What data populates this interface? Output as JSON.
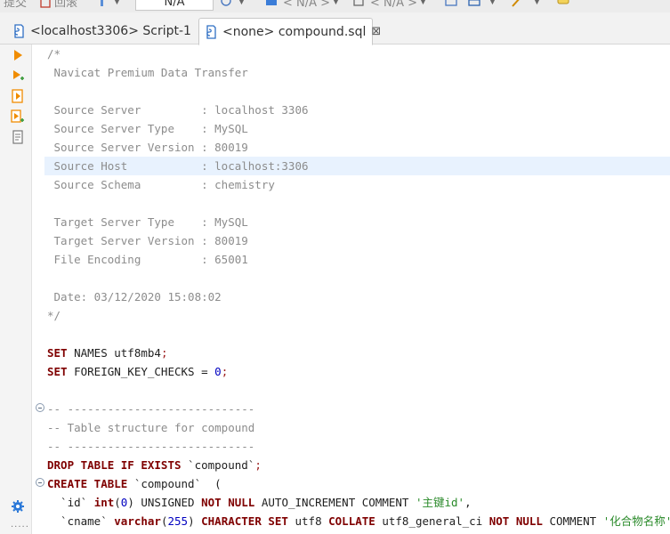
{
  "toolbar": {
    "commit_label": "提交",
    "rollback_label": "回滚",
    "transaction_value": "N/A",
    "datasource_value": "< N/A >",
    "schema_value": "< N/A >"
  },
  "tabs": [
    {
      "label": "<localhost3306> Script-1",
      "active": false
    },
    {
      "label": "<none> compound.sql",
      "active": true,
      "close": "⊠"
    }
  ],
  "gutter_icons": [
    "execute-statement-icon",
    "execute-in-new-tab-icon",
    "execute-script-icon",
    "execute-script-new-tab-icon",
    "explain-plan-icon"
  ],
  "editor": {
    "lines": [
      [
        {
          "t": "/*",
          "c": "cm"
        }
      ],
      [
        {
          "t": " Navicat Premium Data Transfer",
          "c": "cm"
        }
      ],
      [],
      [
        {
          "t": " Source Server         : localhost 3306",
          "c": "cm"
        }
      ],
      [
        {
          "t": " Source Server Type    : MySQL",
          "c": "cm"
        }
      ],
      [
        {
          "t": " Source Server Version : 80019",
          "c": "cm"
        }
      ],
      [
        {
          "t": " Source Host           : localhost:3306",
          "c": "cm"
        }
      ],
      [
        {
          "t": " Source Schema         : chemistry",
          "c": "cm"
        }
      ],
      [],
      [
        {
          "t": " Target Server Type    : MySQL",
          "c": "cm"
        }
      ],
      [
        {
          "t": " Target Server Version : 80019",
          "c": "cm"
        }
      ],
      [
        {
          "t": " File Encoding         : 65001",
          "c": "cm"
        }
      ],
      [],
      [
        {
          "t": " Date: 03/12/2020 15:08:02",
          "c": "cm"
        }
      ],
      [
        {
          "t": "*/",
          "c": "cm"
        }
      ],
      [],
      [
        {
          "t": "SET",
          "c": "kw"
        },
        {
          "t": " NAMES utf8mb4",
          "c": "pl"
        },
        {
          "t": ";",
          "c": "pn"
        }
      ],
      [
        {
          "t": "SET",
          "c": "kw"
        },
        {
          "t": " FOREIGN_KEY_CHECKS = ",
          "c": "pl"
        },
        {
          "t": "0",
          "c": "num"
        },
        {
          "t": ";",
          "c": "pn"
        }
      ],
      [],
      [
        {
          "t": "-- ----------------------------",
          "c": "cm"
        }
      ],
      [
        {
          "t": "-- Table structure for compound",
          "c": "cm"
        }
      ],
      [
        {
          "t": "-- ----------------------------",
          "c": "cm"
        }
      ],
      [
        {
          "t": "DROP TABLE IF EXISTS",
          "c": "kw"
        },
        {
          "t": " `compound`",
          "c": "pl"
        },
        {
          "t": ";",
          "c": "pn"
        }
      ],
      [
        {
          "t": "CREATE TABLE",
          "c": "kw"
        },
        {
          "t": " `compound`  (",
          "c": "pl"
        }
      ],
      [
        {
          "t": "  `id` ",
          "c": "pl"
        },
        {
          "t": "int",
          "c": "kw"
        },
        {
          "t": "(",
          "c": "pl"
        },
        {
          "t": "0",
          "c": "num"
        },
        {
          "t": ") UNSIGNED ",
          "c": "pl"
        },
        {
          "t": "NOT NULL",
          "c": "kw"
        },
        {
          "t": " AUTO_INCREMENT COMMENT ",
          "c": "pl"
        },
        {
          "t": "'主键id'",
          "c": "str"
        },
        {
          "t": ",",
          "c": "pl"
        }
      ],
      [
        {
          "t": "  `cname` ",
          "c": "pl"
        },
        {
          "t": "varchar",
          "c": "kw"
        },
        {
          "t": "(",
          "c": "pl"
        },
        {
          "t": "255",
          "c": "num"
        },
        {
          "t": ") ",
          "c": "pl"
        },
        {
          "t": "CHARACTER SET",
          "c": "kw"
        },
        {
          "t": " utf8 ",
          "c": "pl"
        },
        {
          "t": "COLLATE",
          "c": "kw"
        },
        {
          "t": " utf8_general_ci ",
          "c": "pl"
        },
        {
          "t": "NOT NULL",
          "c": "kw"
        },
        {
          "t": " COMMENT ",
          "c": "pl"
        },
        {
          "t": "'化合物名称'",
          "c": "str"
        }
      ]
    ]
  },
  "colors": {
    "keyword": "#7f0000",
    "comment": "#8c8c8c",
    "number": "#0000c0",
    "string": "#2a8a2a",
    "current_line": "#e8f2fe"
  }
}
